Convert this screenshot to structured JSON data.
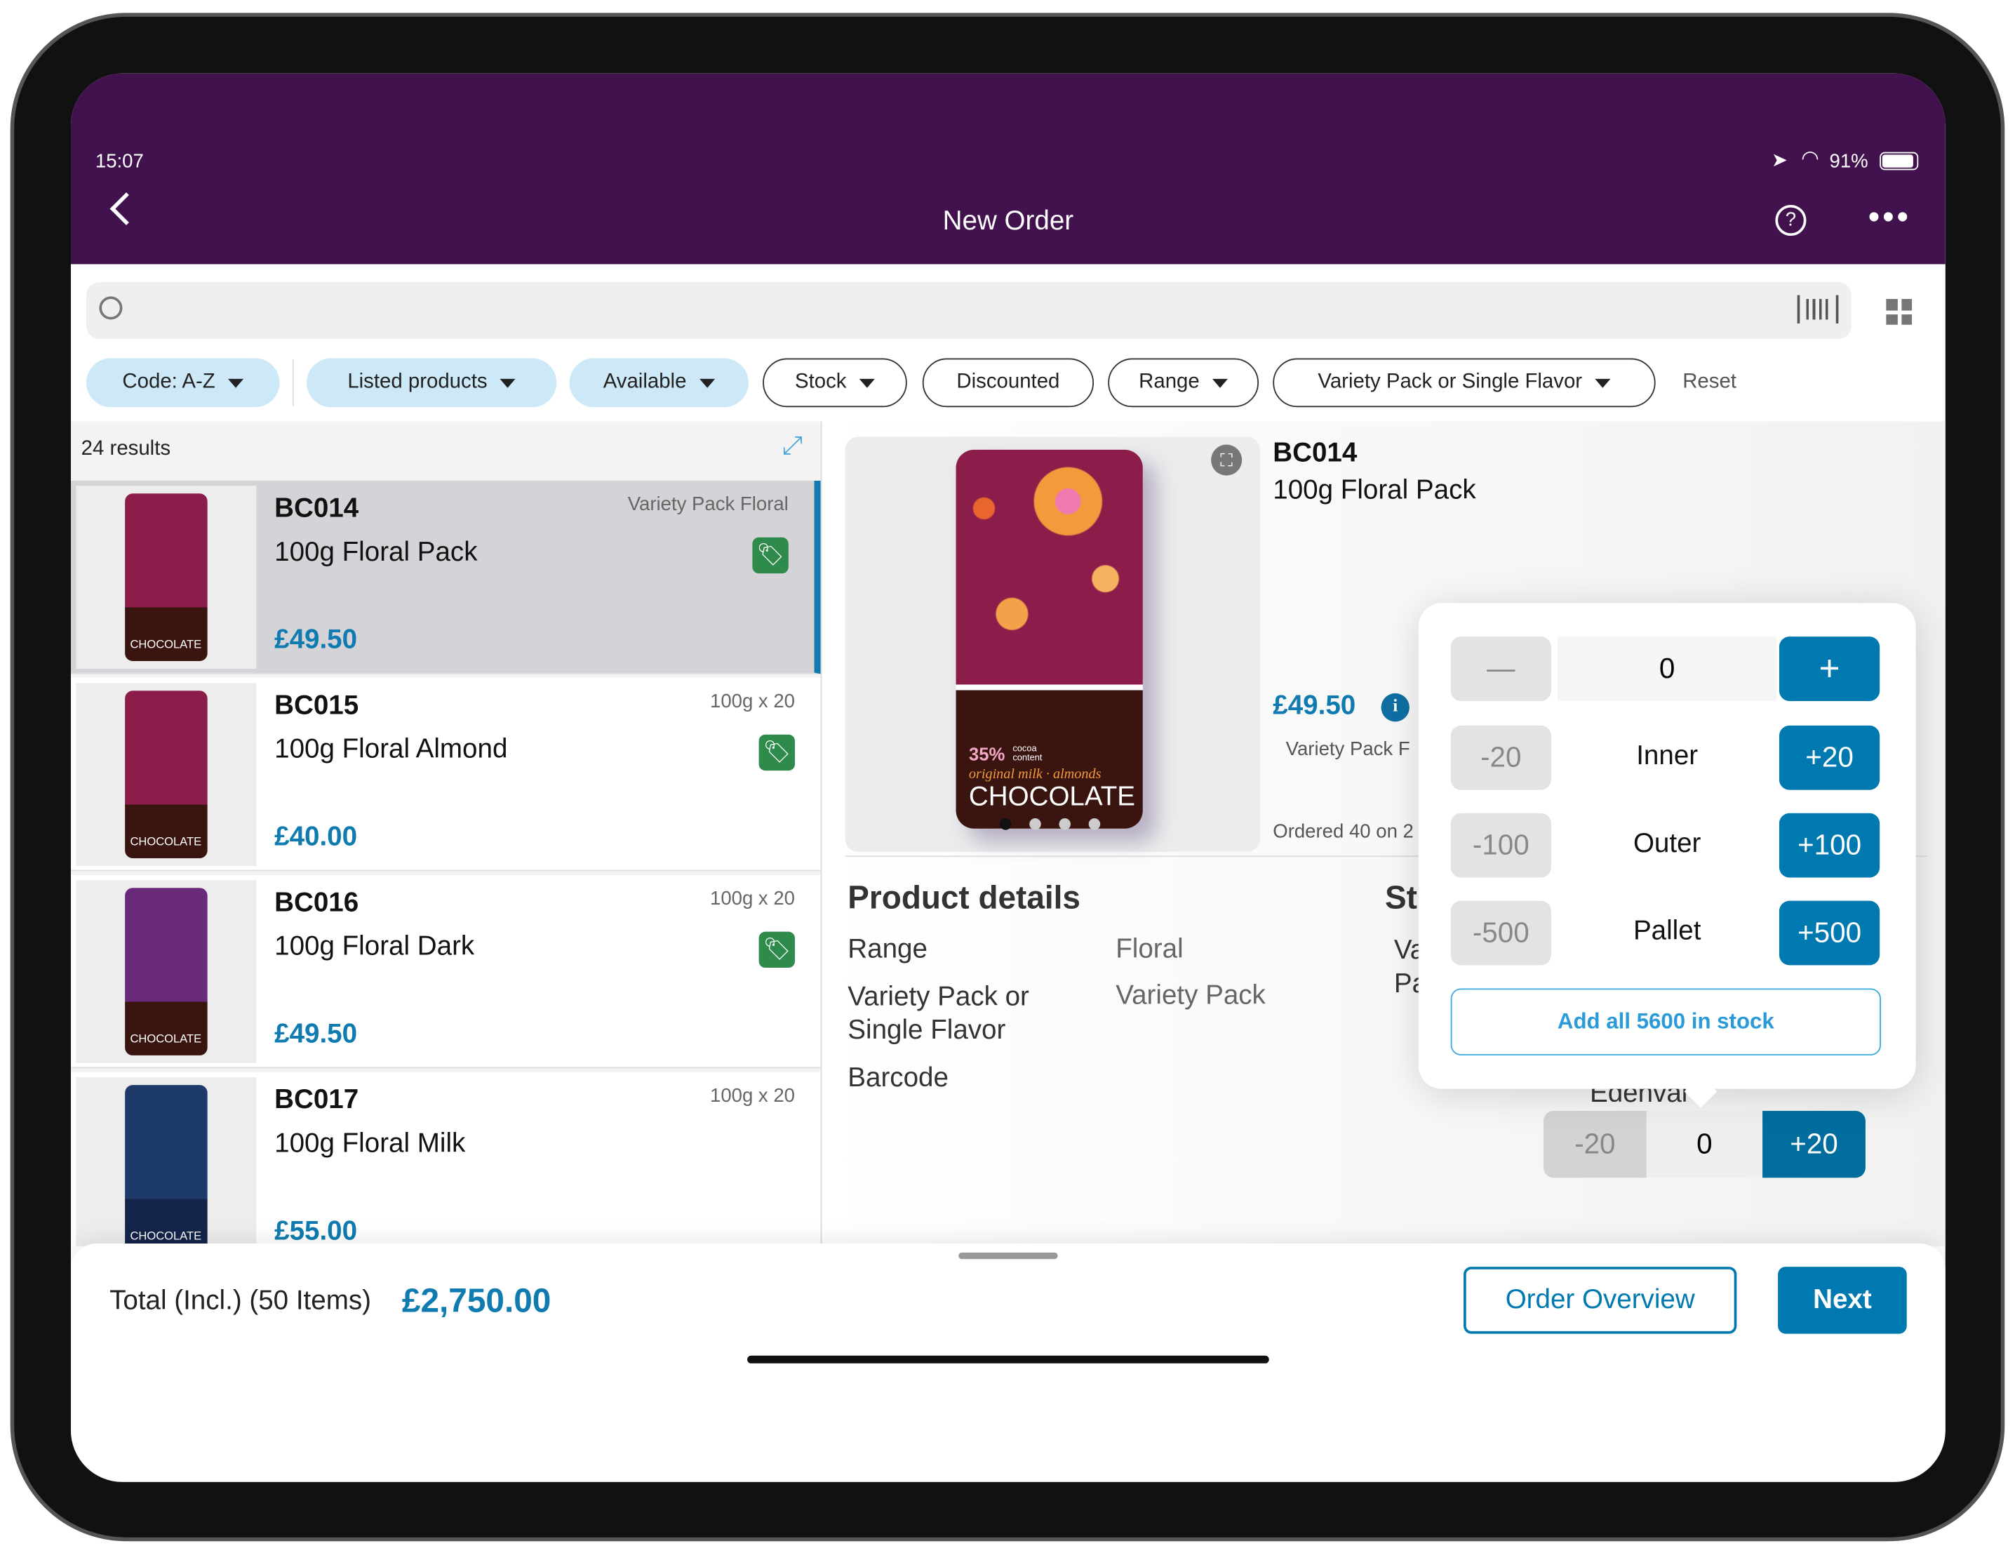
{
  "status": {
    "time": "15:07",
    "battery": "91%"
  },
  "header": {
    "title": "New Order"
  },
  "filters": [
    {
      "label": "Code: A-Z",
      "filled": true
    },
    {
      "label": "Listed products",
      "filled": true
    },
    {
      "label": "Available",
      "filled": true
    },
    {
      "label": "Stock",
      "filled": false
    },
    {
      "label": "Discounted",
      "filled": false
    },
    {
      "label": "Range",
      "filled": false
    },
    {
      "label": "Variety Pack or Single Flavor",
      "filled": false
    }
  ],
  "reset": "Reset",
  "results": "24 results",
  "products": [
    {
      "code": "BC014",
      "name": "100g Floral Pack",
      "price": "£49.50",
      "meta": "Variety Pack Floral",
      "tag": true,
      "selected": true
    },
    {
      "code": "BC015",
      "name": "100g Floral Almond",
      "price": "£40.00",
      "meta": "100g x 20",
      "tag": true
    },
    {
      "code": "BC016",
      "name": "100g Floral Dark",
      "price": "£49.50",
      "meta": "100g x 20",
      "tag": true
    },
    {
      "code": "BC017",
      "name": "100g Floral Milk",
      "price": "£55.00",
      "meta": "100g x 20",
      "tag": false
    }
  ],
  "detail": {
    "code": "BC014",
    "name": "100g Floral Pack",
    "price": "£49.50",
    "sub": "Variety Pack F",
    "ordered": "Ordered 40 on 2",
    "image_text": {
      "pct": "35%",
      "cocoa": "cocoa content",
      "line": "original milk · almonds",
      "brand": "CHOCOLATE"
    },
    "section": "Product details",
    "section2": "St",
    "rows": [
      {
        "k": "Range",
        "v": "Floral"
      },
      {
        "k": "Variety Pack or Single Flavor",
        "v": "Variety Pack"
      },
      {
        "k": "Barcode",
        "v": ""
      }
    ],
    "side": "Va Pa",
    "warehouse": "Edenval",
    "stepper": {
      "minus": "-20",
      "value": "0",
      "plus": "+20"
    }
  },
  "popover": {
    "value": "0",
    "minus": "—",
    "plus": "+",
    "rows": [
      {
        "minus": "-20",
        "label": "Inner",
        "plus": "+20"
      },
      {
        "minus": "-100",
        "label": "Outer",
        "plus": "+100"
      },
      {
        "minus": "-500",
        "label": "Pallet",
        "plus": "+500"
      }
    ],
    "add_all": "Add all 5600 in stock"
  },
  "footer": {
    "total_label": "Total (Incl.) (50 Items)",
    "total": "£2,750.00",
    "overview": "Order Overview",
    "next": "Next"
  },
  "colors": {
    "header": "#42124f",
    "accent": "#0079b1",
    "tag": "#2e8b4c"
  }
}
